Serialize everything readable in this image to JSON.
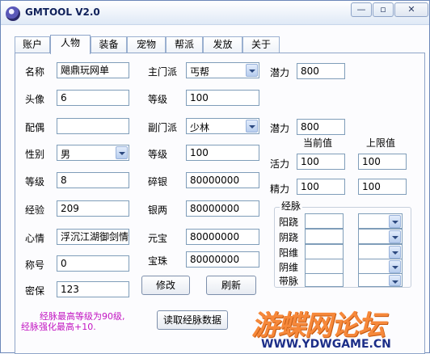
{
  "window": {
    "title": "GMTOOL  V2.0",
    "controls": {
      "minimize": "—",
      "maximize": "▫",
      "close": "✕"
    }
  },
  "tabs": [
    "账户",
    "人物",
    "装备",
    "宠物",
    "帮派",
    "发放",
    "关于"
  ],
  "active_tab": "人物",
  "col1": {
    "name": {
      "label": "名称",
      "value": "飓鼎玩网单"
    },
    "avatar": {
      "label": "头像",
      "value": "6"
    },
    "spouse": {
      "label": "配偶",
      "value": ""
    },
    "gender": {
      "label": "性别",
      "value": "男"
    },
    "level": {
      "label": "等级",
      "value": "8"
    },
    "exp": {
      "label": "经验",
      "value": "209"
    },
    "mood": {
      "label": "心情",
      "value": "浮沉江湖御剑情"
    },
    "title": {
      "label": "称号",
      "value": "0"
    },
    "security": {
      "label": "密保",
      "value": "123"
    }
  },
  "col2": {
    "main_sect": {
      "label": "主门派",
      "value": "丐帮"
    },
    "main_level": {
      "label": "等级",
      "value": "100"
    },
    "sub_sect": {
      "label": "副门派",
      "value": "少林"
    },
    "sub_level": {
      "label": "等级",
      "value": "100"
    },
    "silver_ore": {
      "label": "碎银",
      "value": "80000000"
    },
    "silver": {
      "label": "银两",
      "value": "80000000"
    },
    "yuanbao": {
      "label": "元宝",
      "value": "80000000"
    },
    "pearl": {
      "label": "宝珠",
      "value": "80000000"
    }
  },
  "col3": {
    "potential1": {
      "label": "潜力",
      "value": "800"
    },
    "potential2": {
      "label": "潜力",
      "value": "800"
    },
    "header_current": "当前值",
    "header_max": "上限值",
    "vitality": {
      "label": "活力",
      "current": "100",
      "max": "100"
    },
    "energy": {
      "label": "精力",
      "current": "100",
      "max": "100"
    }
  },
  "meridians": {
    "title": "经脉",
    "rows": [
      "阳跷",
      "阴跷",
      "阳维",
      "阴维",
      "带脉"
    ]
  },
  "buttons": {
    "modify": "修改",
    "refresh": "刷新",
    "read_meridian": "读取经脉数据"
  },
  "note": {
    "line1": "经脉最高等级为90级,",
    "line2": "经脉强化最高+10."
  },
  "watermark": {
    "main": "游蝶网论坛",
    "sub": "WWW.YDWGAME.CN"
  },
  "colors": {
    "note": "#c215c2",
    "watermark_main": "#f6883a",
    "watermark_sub": "#1c2e88",
    "border": "#7f9db9"
  }
}
